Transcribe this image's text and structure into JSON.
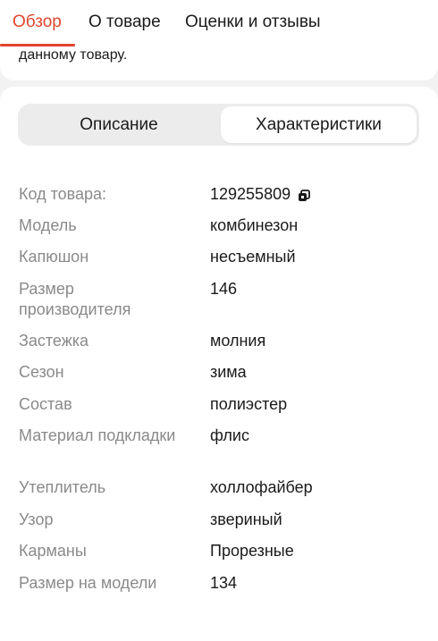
{
  "tabs": [
    {
      "label": "Обзор",
      "active": true
    },
    {
      "label": "О товаре",
      "active": false
    },
    {
      "label": "Оценки и отзывы",
      "active": false
    }
  ],
  "description_tail": "данному товару.",
  "segmented": {
    "left_label": "Описание",
    "right_label": "Характеристики",
    "selected": "Характеристики"
  },
  "specs": [
    {
      "label": "Код товара:",
      "value": "129255809",
      "copy_icon": "copy-icon"
    },
    {
      "label": "Модель",
      "value": "комбинезон"
    },
    {
      "label": "Капюшон",
      "value": "несъемный"
    },
    {
      "label": "Размер производителя",
      "value": "146"
    },
    {
      "label": "Застежка",
      "value": "молния"
    },
    {
      "label": "Сезон",
      "value": "зима"
    },
    {
      "label": "Состав",
      "value": "полиэстер"
    },
    {
      "label": "Материал подкладки",
      "value": "флис"
    },
    {
      "label": "Утеплитель",
      "value": "холлофайбер"
    },
    {
      "label": "Узор",
      "value": "звериный"
    },
    {
      "label": "Карманы",
      "value": "Прорезные"
    },
    {
      "label": "Размер на модели",
      "value": "134"
    }
  ],
  "colors": {
    "accent": "#e0452d",
    "label_gray": "#8a8a8a",
    "background": "#f2f2f2"
  }
}
